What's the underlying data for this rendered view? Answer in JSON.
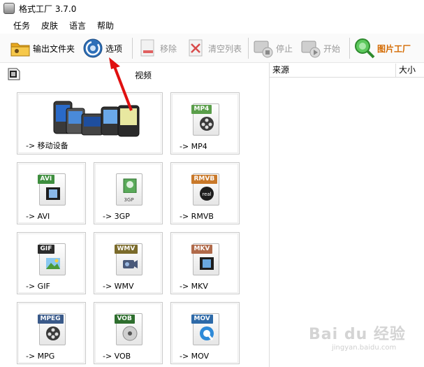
{
  "window": {
    "title": "格式工厂 3.7.0"
  },
  "menu": {
    "items": [
      "任务",
      "皮肤",
      "语言",
      "帮助"
    ]
  },
  "toolbar": {
    "output_folder": "输出文件夹",
    "options": "选项",
    "remove": "移除",
    "clear_list": "清空列表",
    "stop": "停止",
    "start": "开始",
    "picture_factory": "图片工厂"
  },
  "category": {
    "label": "视频"
  },
  "tiles": {
    "mobile": {
      "label": "-> 移动设备"
    },
    "mp4": {
      "label": "-> MP4",
      "tag": "MP4"
    },
    "avi": {
      "label": "-> AVI",
      "tag": "AVI"
    },
    "gp3": {
      "label": "-> 3GP",
      "tag": "3GP"
    },
    "rmvb": {
      "label": "-> RMVB",
      "tag": "RMVB"
    },
    "gif": {
      "label": "-> GIF",
      "tag": "GIF"
    },
    "wmv": {
      "label": "-> WMV",
      "tag": "WMV"
    },
    "mkv": {
      "label": "-> MKV",
      "tag": "MKV"
    },
    "mpg": {
      "label": "-> MPG",
      "tag": "MPEG"
    },
    "vob": {
      "label": "-> VOB",
      "tag": "VOB"
    },
    "mov": {
      "label": "-> MOV",
      "tag": "MOV"
    }
  },
  "list": {
    "col_source": "来源",
    "col_size": "大小"
  },
  "colors": {
    "mp4": "#5a9e4a",
    "avi": "#3e8e3e",
    "rmvb": "#c9792a",
    "gif": "#2b2b2b",
    "wmv": "#7a6a2a",
    "mkv": "#b06a4a",
    "mpeg": "#3a5a8a",
    "vob": "#2e6e2e",
    "mov": "#2e6aa8",
    "arrow": "#e01010",
    "accent": "#d46a00"
  },
  "watermark": {
    "logo": "Bai du 经验",
    "url": "jingyan.baidu.com"
  }
}
